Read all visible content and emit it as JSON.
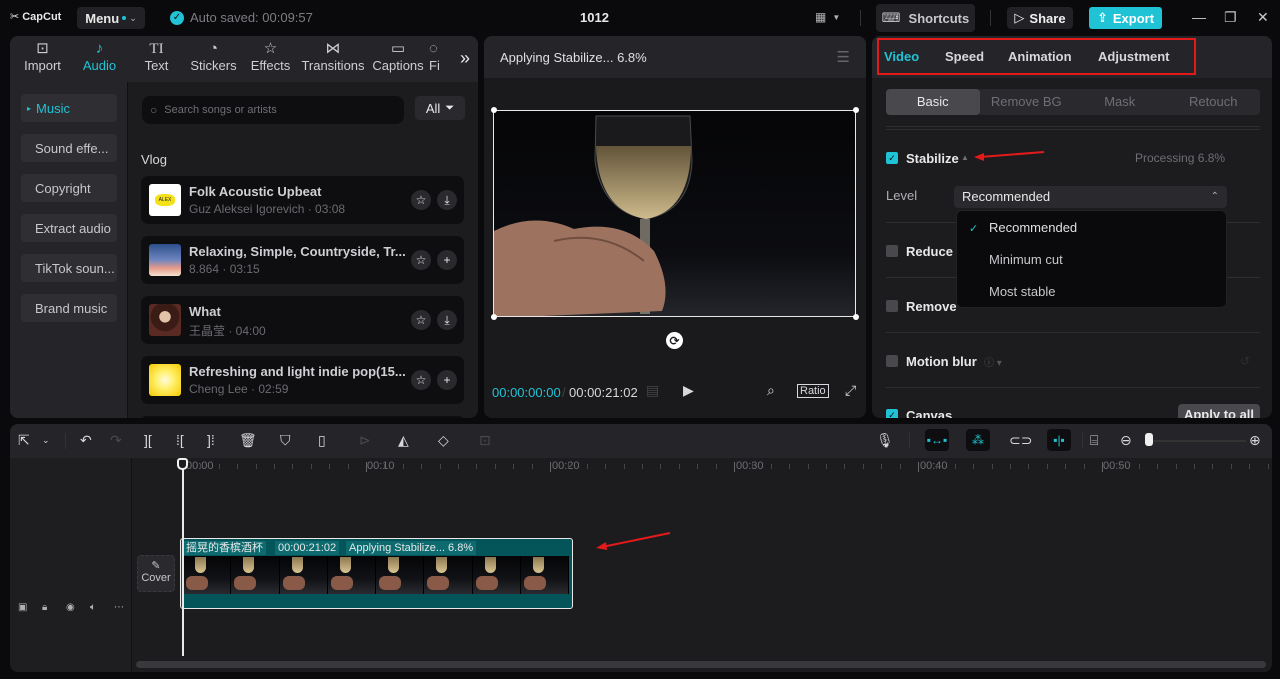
{
  "app": {
    "name": "CapCut",
    "menu_label": "Menu",
    "autosave": "Auto saved: 00:09:57",
    "project_title": "1012",
    "shortcuts_label": "Shortcuts",
    "share_label": "Share",
    "export_label": "Export",
    "accent_color": "#1fc3d5"
  },
  "media_tabs": [
    {
      "label": "Import",
      "icon": "import-icon"
    },
    {
      "label": "Audio",
      "icon": "audio-icon",
      "active": true
    },
    {
      "label": "Text",
      "icon": "text-icon"
    },
    {
      "label": "Stickers",
      "icon": "stickers-icon"
    },
    {
      "label": "Effects",
      "icon": "effects-icon"
    },
    {
      "label": "Transitions",
      "icon": "transitions-icon"
    },
    {
      "label": "Captions",
      "icon": "captions-icon"
    },
    {
      "label": "Fi",
      "icon": "filters-icon"
    }
  ],
  "audio_sidebar": [
    {
      "label": "Music",
      "active": true
    },
    {
      "label": "Sound effe..."
    },
    {
      "label": "Copyright"
    },
    {
      "label": "Extract audio"
    },
    {
      "label": "TikTok soun..."
    },
    {
      "label": "Brand music"
    }
  ],
  "music": {
    "search_placeholder": "Search songs or artists",
    "filter_label": "All",
    "section_title": "Vlog",
    "songs": [
      {
        "title": "Folk Acoustic Upbeat",
        "subtitle": "Guz Aleksei Igorevich · 03:08",
        "action": "download"
      },
      {
        "title": "Relaxing, Simple, Countryside, Tr...",
        "subtitle": "8.864 · 03:15",
        "action": "add"
      },
      {
        "title": "What",
        "subtitle": "王晶莹 · 04:00",
        "action": "download"
      },
      {
        "title": "Refreshing and light indie pop(15...",
        "subtitle": "Cheng Lee · 02:59",
        "action": "add"
      }
    ]
  },
  "player": {
    "title": "Applying Stabilize... 6.8%",
    "current_time": "00:00:00:00",
    "total_time": "00:00:21:02",
    "ratio_label": "Ratio"
  },
  "inspector": {
    "tabs": [
      {
        "label": "Video",
        "active": true
      },
      {
        "label": "Speed"
      },
      {
        "label": "Animation"
      },
      {
        "label": "Adjustment"
      }
    ],
    "subtabs": [
      {
        "label": "Basic",
        "active": true
      },
      {
        "label": "Remove BG"
      },
      {
        "label": "Mask"
      },
      {
        "label": "Retouch"
      }
    ],
    "stabilize": {
      "label": "Stabilize",
      "checked": true,
      "status": "Processing 6.8%"
    },
    "level": {
      "label": "Level",
      "selected": "Recommended",
      "options": [
        "Recommended",
        "Minimum cut",
        "Most stable"
      ]
    },
    "reduce_label": "Reduce",
    "remove_label": "Remove",
    "motion_blur_label": "Motion blur",
    "canvas_label": "Canvas",
    "apply_all_label": "Apply to all"
  },
  "timeline": {
    "ruler": [
      "00:00",
      "00:10",
      "00:20",
      "00:30",
      "00:40",
      "00:50"
    ],
    "cover_label": "Cover",
    "clip": {
      "name": "摇晃的香槟酒杯",
      "duration": "00:00:21:02",
      "status": "Applying Stabilize... 6.8%"
    }
  }
}
